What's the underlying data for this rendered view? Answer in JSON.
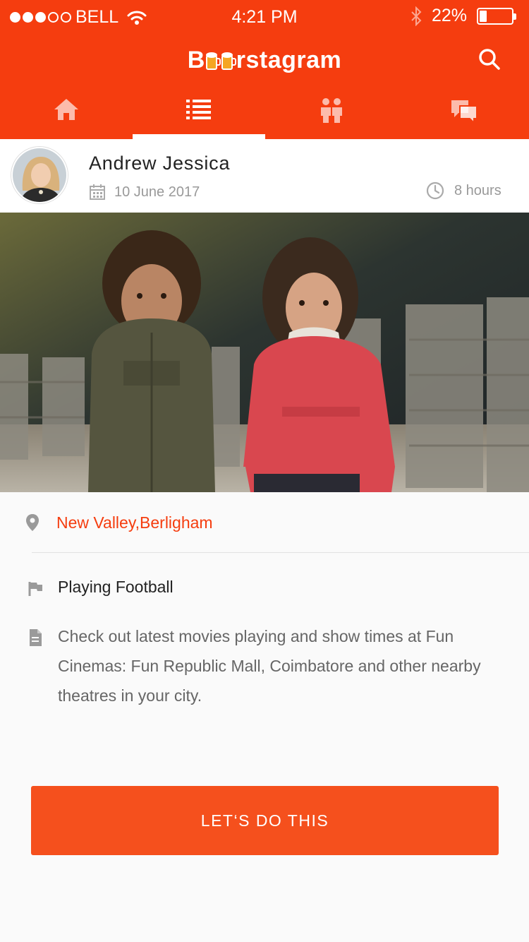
{
  "status_bar": {
    "carrier": "BELL",
    "time": "4:21 PM",
    "battery": "22%",
    "battery_level": 0.22
  },
  "header": {
    "brand_prefix": "B",
    "brand_suffix": "rstagram",
    "search_icon": "search-icon"
  },
  "tabs": [
    {
      "icon": "home-icon"
    },
    {
      "icon": "list-icon",
      "active": true
    },
    {
      "icon": "people-icon"
    },
    {
      "icon": "chat-icon"
    }
  ],
  "post": {
    "author": "Andrew Jessica",
    "date": "10 June 2017",
    "time_ago": "8 hours",
    "location": "New Valley,Berligham",
    "activity": "Playing Football",
    "description": "Check out latest movies playing and show times at Fun Cinemas: Fun Republic Mall, Coimbatore and other nearby theatres in your city."
  },
  "cta": {
    "label": "LET‘S DO THIS"
  },
  "colors": {
    "accent": "#f53d0f",
    "button": "#f5501d",
    "muted": "#999999"
  }
}
